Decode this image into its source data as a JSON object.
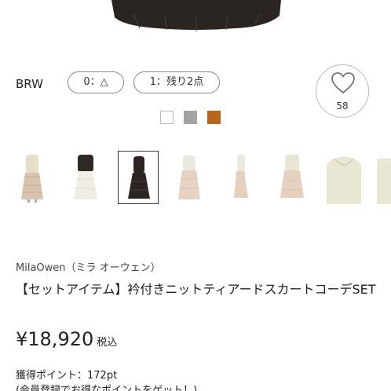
{
  "product_color": {
    "label": "BRW",
    "stock_options": [
      "0：△",
      "1：残り2点"
    ]
  },
  "favorite": {
    "icon": "heart-icon",
    "count": "58"
  },
  "color_swatches": [
    {
      "name": "white",
      "color": "#ffffff"
    },
    {
      "name": "gray",
      "color": "#a3a3a3"
    },
    {
      "name": "brown",
      "color": "#b5651d"
    }
  ],
  "thumbnails": {
    "selected_index": 2,
    "count_visible": 9
  },
  "product": {
    "brand": "MilaOwen（ミラ オーウェン）",
    "title": "【セットアイテム】衿付きニットティアードスカートコーデSET",
    "price": "¥18,920",
    "tax_label": "税込",
    "points": "獲得ポイント：172pt",
    "points_note": "(会員登録でお得なポイントをゲット！)"
  }
}
